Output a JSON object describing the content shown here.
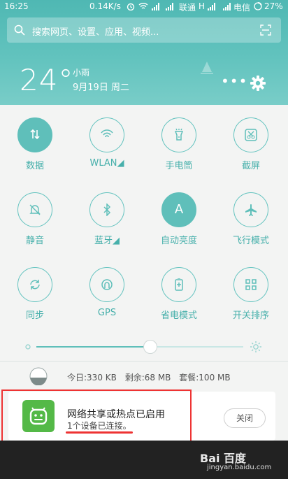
{
  "status": {
    "time": "16:25",
    "speed": "0.14K/s",
    "carrier1": "联通",
    "network1": "H",
    "carrier2": "电信",
    "battery": "27%"
  },
  "search": {
    "placeholder": "搜索网页、设置、应用、视频..."
  },
  "weather": {
    "temp": "24°",
    "condition": "小雨",
    "date": "9月19日 周二"
  },
  "more_label": "•••",
  "toggles": [
    {
      "label": "数据",
      "icon": "data-arrows-icon",
      "on": true
    },
    {
      "label": "WLAN◢",
      "icon": "wifi-icon",
      "on": false
    },
    {
      "label": "手电筒",
      "icon": "flashlight-icon",
      "on": false
    },
    {
      "label": "截屏",
      "icon": "screenshot-icon",
      "on": false
    },
    {
      "label": "静音",
      "icon": "mute-bell-icon",
      "on": false
    },
    {
      "label": "蓝牙◢",
      "icon": "bluetooth-icon",
      "on": false
    },
    {
      "label": "自动亮度",
      "icon": "auto-brightness-icon",
      "on": true,
      "glyph": "A"
    },
    {
      "label": "飞行模式",
      "icon": "airplane-icon",
      "on": false
    },
    {
      "label": "同步",
      "icon": "sync-icon",
      "on": false
    },
    {
      "label": "GPS",
      "icon": "gps-icon",
      "on": false
    },
    {
      "label": "省电模式",
      "icon": "battery-saver-icon",
      "on": false
    },
    {
      "label": "开关排序",
      "icon": "grid-sort-icon",
      "on": false
    }
  ],
  "brightness": {
    "level": 0.55
  },
  "data_usage": {
    "today": "今日:330 KB",
    "remaining": "剩余:68 MB",
    "plan": "套餐:100 MB"
  },
  "notification": {
    "title": "网络共享或热点已启用",
    "subtitle": "1个设备已连接。",
    "close_label": "关闭"
  },
  "watermark": {
    "brand": "Bai 百度",
    "site": "jingyan.baidu.com"
  },
  "colors": {
    "accent": "#5fbfba",
    "annotation": "#e33333",
    "app_icon": "#54b947"
  }
}
